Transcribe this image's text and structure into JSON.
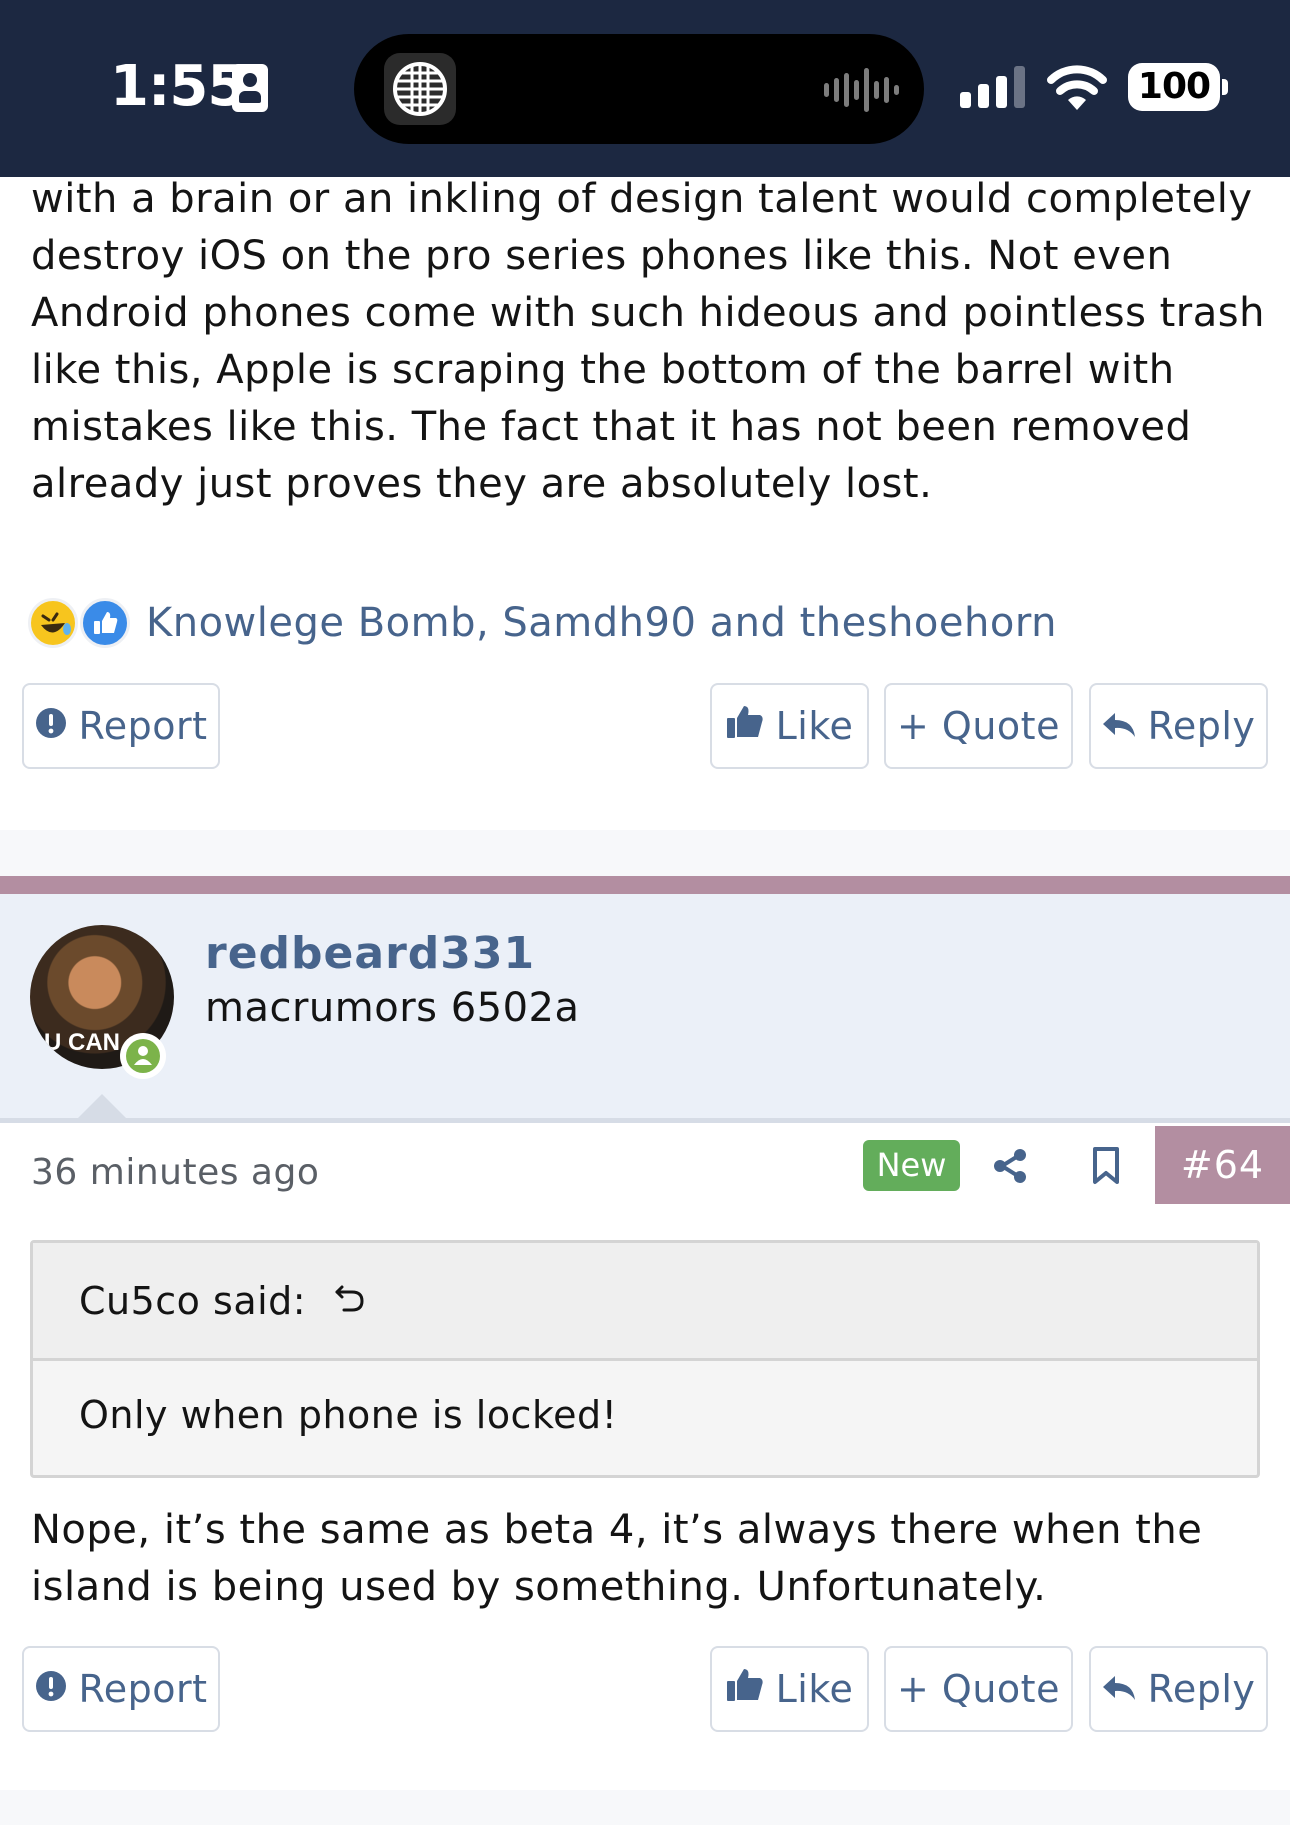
{
  "status_bar": {
    "time": "1:55",
    "battery": "100",
    "icons": [
      "contact-card-icon",
      "globe-icon",
      "audio-waveform-icon",
      "cellular-signal-icon",
      "wifi-icon",
      "battery-icon"
    ]
  },
  "previous_post": {
    "body": "with a brain or an inkling of design talent would completely destroy iOS on the pro series phones like this. Not even Android phones come with such hideous and pointless trash like this, Apple is scraping the bottom of the barrel with mistakes like this. The fact that it has not been removed already just proves they are absolutely lost.",
    "reactions": {
      "icons": [
        "laugh-reaction-icon",
        "like-reaction-icon"
      ],
      "names": "Knowlege Bomb, Samdh90 and theshoehorn"
    },
    "actions": {
      "report": "Report",
      "like": "Like",
      "quote": "+ Quote",
      "reply": "Reply"
    }
  },
  "post": {
    "author": {
      "username": "redbeard331",
      "title": "macrumors 6502a",
      "avatar_caption": "U CAN",
      "online": true
    },
    "time": "36 minutes ago",
    "badge": "New",
    "number": "#64",
    "quote": {
      "author": "Cu5co said:",
      "body": "Only when phone is locked!"
    },
    "body": "Nope, it’s the same as beta 4, it’s always there when the island is being used by something. Unfortunately.",
    "actions": {
      "report": "Report",
      "like": "Like",
      "quote": "+ Quote",
      "reply": "Reply"
    }
  },
  "colors": {
    "status_bar_bg": "#1c2841",
    "link": "#47648c",
    "accent": "#b38ea1",
    "new_badge": "#63ad5b",
    "user_block_bg": "#ebf0f8"
  }
}
